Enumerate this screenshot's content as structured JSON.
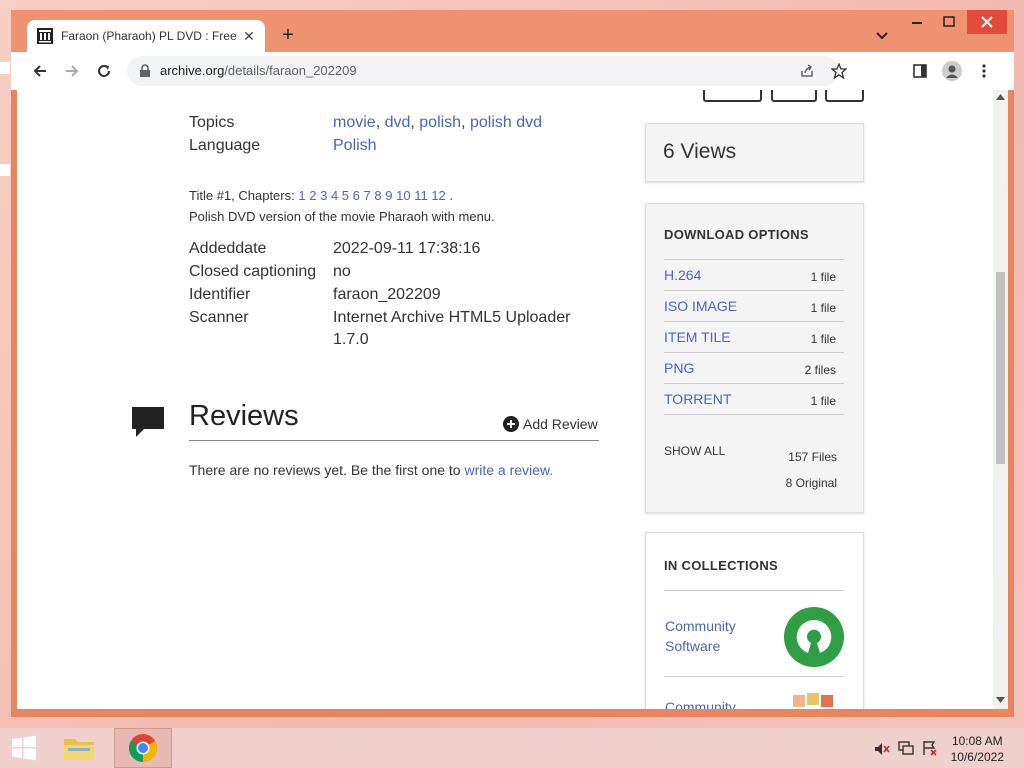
{
  "browser": {
    "tab_title": "Faraon (Pharaoh) PL DVD : Free D",
    "new_tab": "+",
    "url_host": "archive.org",
    "url_path": "/details/faraon_202209"
  },
  "metadata": {
    "topics_label": "Topics",
    "topics": [
      "movie",
      "dvd",
      "polish",
      "polish dvd"
    ],
    "language_label": "Language",
    "language": "Polish",
    "chapters_prefix": "Title #1, Chapters:",
    "chapters": [
      "1",
      "2",
      "3",
      "4",
      "5",
      "6",
      "7",
      "8",
      "9",
      "10",
      "11",
      "12"
    ],
    "chapters_suffix": ".",
    "description": "Polish DVD version of the movie Pharaoh with menu.",
    "fields": [
      {
        "label": "Addeddate",
        "value": "2022-09-11 17:38:16"
      },
      {
        "label": "Closed captioning",
        "value": "no"
      },
      {
        "label": "Identifier",
        "value": "faraon_202209"
      },
      {
        "label": "Scanner",
        "value": "Internet Archive HTML5 Uploader",
        "value2": "1.7.0"
      }
    ]
  },
  "reviews": {
    "title": "Reviews",
    "add_label": "Add Review",
    "empty_text": "There are no reviews yet. Be the first one to",
    "write_link": "write a review."
  },
  "sidebar": {
    "views": "6 Views",
    "download_title": "DOWNLOAD OPTIONS",
    "downloads": [
      {
        "name": "H.264",
        "count": "1 file"
      },
      {
        "name": "ISO IMAGE",
        "count": "1 file"
      },
      {
        "name": "ITEM TILE",
        "count": "1 file"
      },
      {
        "name": "PNG",
        "count": "2 files"
      },
      {
        "name": "TORRENT",
        "count": "1 file"
      }
    ],
    "show_all": "SHOW ALL",
    "total_files": "157 Files",
    "original_files": "8 Original",
    "collections_title": "IN COLLECTIONS",
    "collections": [
      "Community Software",
      "Community"
    ]
  },
  "taskbar": {
    "time": "10:08 AM",
    "date": "10/6/2022"
  },
  "colors": {
    "link": "#4b64c2",
    "frame": "#ef9272",
    "collection_logo": "#2f9e44"
  }
}
